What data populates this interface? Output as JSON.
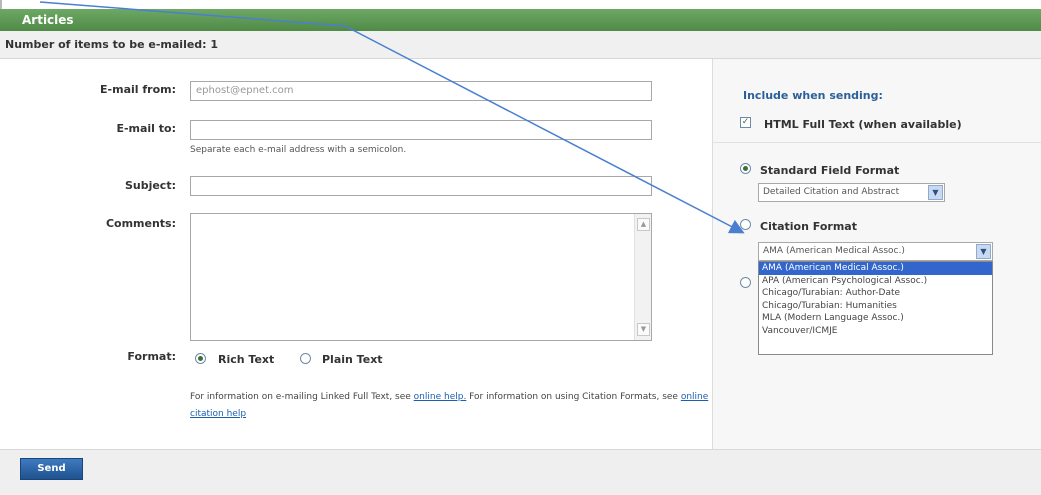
{
  "header": {
    "title": "Articles"
  },
  "subheader": {
    "text": "Number of items to be e-mailed: 1"
  },
  "form": {
    "email_from": {
      "label": "E-mail from:",
      "value": "ephost@epnet.com"
    },
    "email_to": {
      "label": "E-mail to:",
      "value": "",
      "hint": "Separate each e-mail address with a semicolon."
    },
    "subject": {
      "label": "Subject:",
      "value": ""
    },
    "comments": {
      "label": "Comments:"
    },
    "format": {
      "label": "Format:",
      "rich_text": "Rich Text",
      "plain_text": "Plain Text",
      "selected": "Rich Text"
    },
    "info": {
      "part1": "For information on e-mailing Linked Full Text, see ",
      "link1": "online help.",
      "part2": " For information on using Citation Formats, see ",
      "link2": "online citation help"
    }
  },
  "options": {
    "title": "Include when sending:",
    "html_full_text": {
      "label": "HTML Full Text (when available)",
      "checked": true
    },
    "standard_field_format": {
      "label": "Standard Field Format",
      "selected_value": "Detailed Citation and Abstract"
    },
    "citation_format": {
      "label": "Citation Format",
      "selected_value": "AMA (American Medical Assoc.)"
    },
    "citation_options": [
      "AMA (American Medical Assoc.)",
      "APA (American Psychological Assoc.)",
      "Chicago/Turabian: Author-Date",
      "Chicago/Turabian: Humanities",
      "MLA (Modern Language Assoc.)",
      "Vancouver/ICMJE"
    ]
  },
  "footer": {
    "send_label": "Send"
  },
  "colors": {
    "header_green": "#5a9651",
    "link_blue": "#1a5fb0",
    "selected_blue": "#3366cc",
    "arrow_blue": "#4a7fd0"
  }
}
